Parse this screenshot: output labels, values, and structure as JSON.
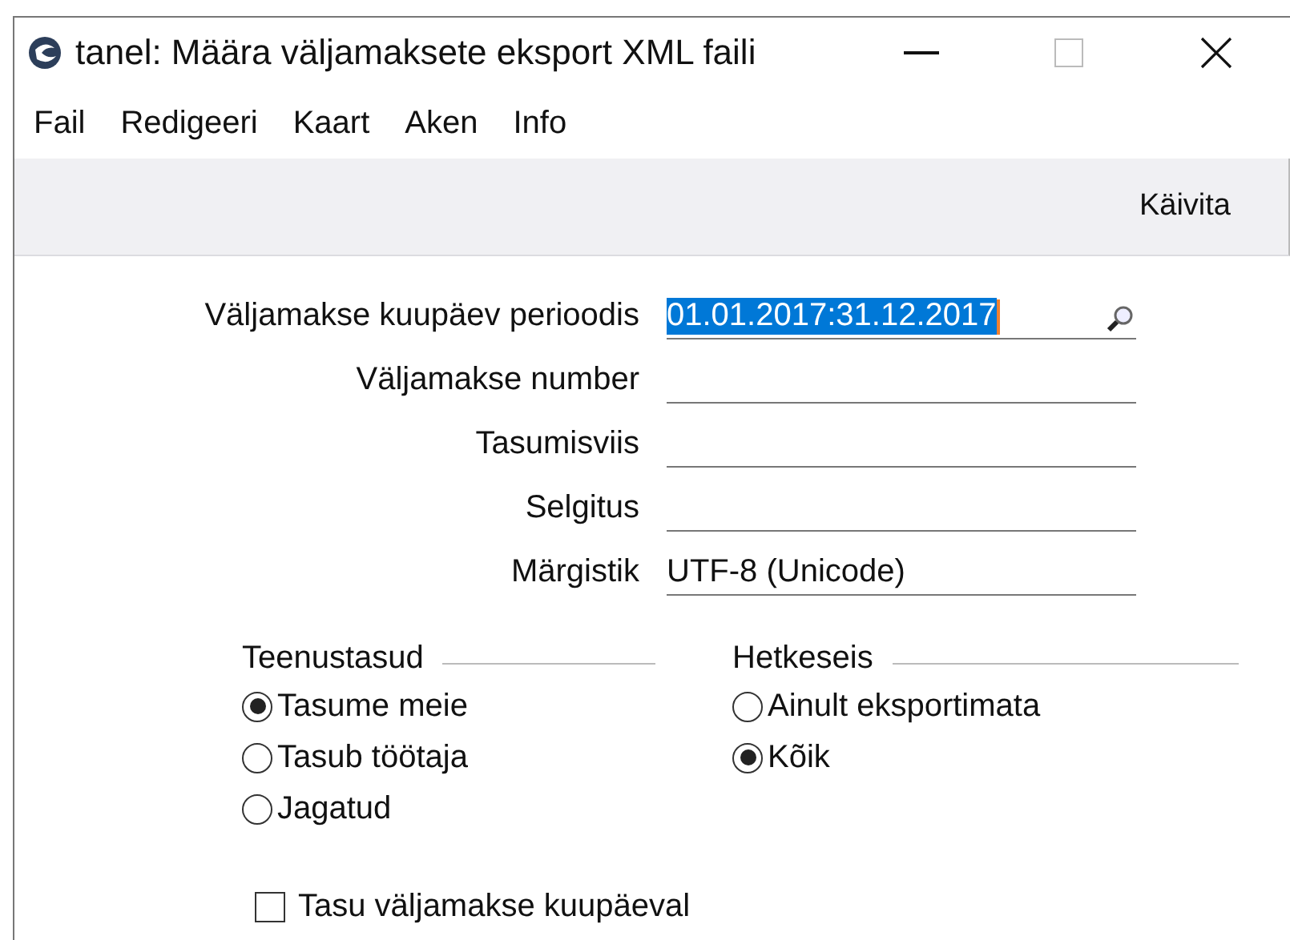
{
  "window": {
    "title": "tanel: Määra väljamaksete eksport XML faili"
  },
  "menu": [
    "Fail",
    "Redigeeri",
    "Kaart",
    "Aken",
    "Info"
  ],
  "toolbar": {
    "button": "Käivita"
  },
  "fields": [
    {
      "label": "Väljamakse kuupäev perioodis",
      "value": "01.01.2017:31.12.2017",
      "selected": true,
      "kind": "lookup"
    },
    {
      "label": "Väljamakse number",
      "selected": false,
      "kind": "text"
    },
    {
      "label": "Tasumisviis",
      "selected": false,
      "kind": "text"
    },
    {
      "label": "Selgitus",
      "selected": false,
      "kind": "text"
    },
    {
      "label": "Märgistik",
      "value": "UTF-8 (Unicode)",
      "selected": false,
      "kind": "text"
    }
  ],
  "groups": [
    {
      "title": "Teenustasud",
      "options": [
        {
          "label": "Tasume meie",
          "selected": true
        },
        {
          "label": "Tasub töötaja",
          "selected": false
        },
        {
          "label": "Jagatud",
          "selected": false
        }
      ]
    },
    {
      "title": "Hetkeseis",
      "options": [
        {
          "label": "Ainult eksportimata",
          "selected": false
        },
        {
          "label": "Kõik",
          "selected": true
        }
      ]
    }
  ],
  "checkbox": {
    "label": "Tasu väljamakse kuupäeval",
    "checked": false
  }
}
